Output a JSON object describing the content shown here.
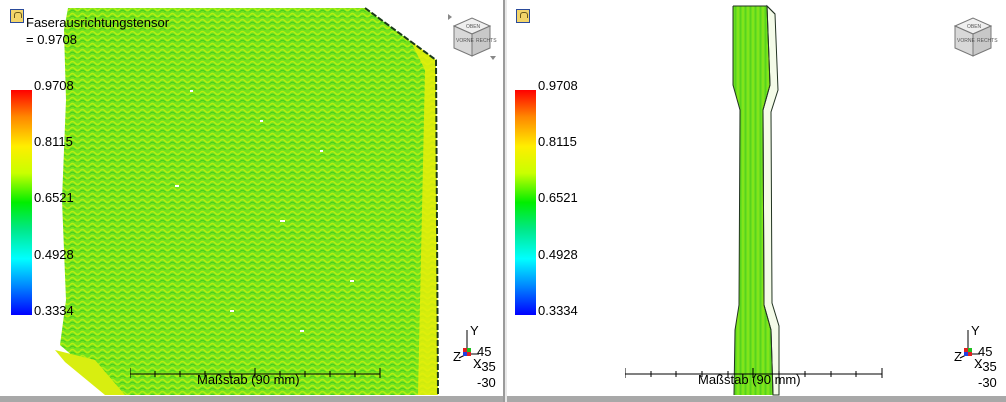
{
  "left_view": {
    "result_title": "Faserausrichtungstensor",
    "max_readout": "= 0.9708",
    "legend": [
      "0.9708",
      "0.8115",
      "0.6521",
      "0.4928",
      "0.3334"
    ],
    "scale_label": "Maßstab (90 mm)",
    "axis_label_y": "Y",
    "axis_label_z": "Z",
    "axis_label_x": "X",
    "coords": [
      "45",
      "-35",
      "-30"
    ],
    "nav_cube_icon": "nav-cube-icon",
    "lock_icon": "lock-icon"
  },
  "right_view": {
    "legend": [
      "0.9708",
      "0.8115",
      "0.6521",
      "0.4928",
      "0.3334"
    ],
    "scale_label": "Maßstab (90 mm)",
    "axis_label_y": "Y",
    "axis_label_z": "Z",
    "axis_label_x": "X",
    "coords": [
      "45",
      "-35",
      "-30"
    ],
    "nav_cube_icon": "nav-cube-icon",
    "lock_icon": "lock-icon"
  },
  "colors": {
    "mesh_green": "#66e020",
    "mesh_yellow": "#d8ee10",
    "legend_max": "#ff0000",
    "legend_min": "#0000ff"
  }
}
